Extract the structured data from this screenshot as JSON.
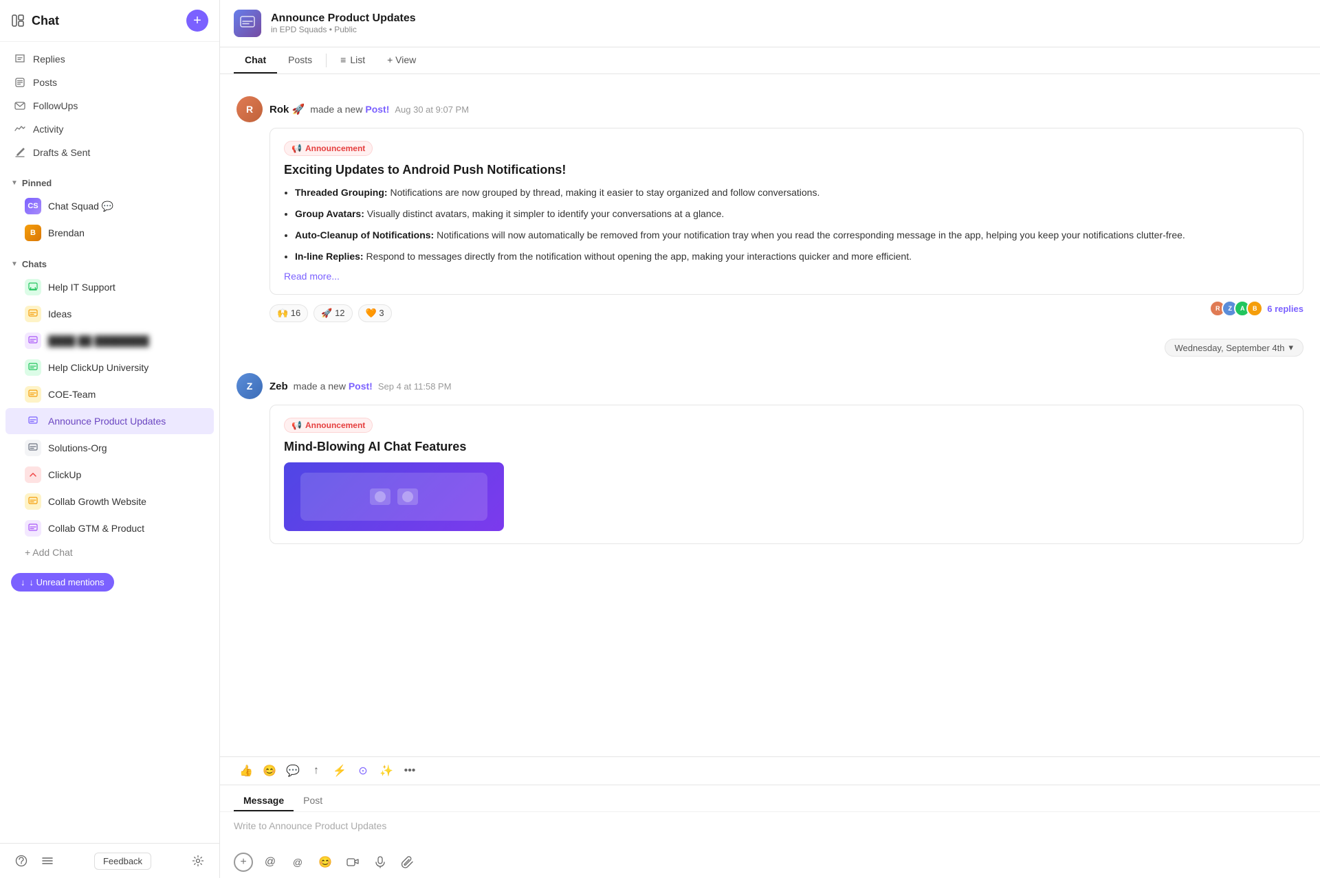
{
  "sidebar": {
    "title": "Chat",
    "add_button_label": "+",
    "nav_items": [
      {
        "id": "replies",
        "label": "Replies",
        "icon": "💬"
      },
      {
        "id": "posts",
        "label": "Posts",
        "icon": "📋"
      },
      {
        "id": "followups",
        "label": "FollowUps",
        "icon": "🔔"
      },
      {
        "id": "activity",
        "label": "Activity",
        "icon": "📊"
      },
      {
        "id": "drafts",
        "label": "Drafts & Sent",
        "icon": "✉️"
      }
    ],
    "pinned_section": {
      "label": "Pinned",
      "items": [
        {
          "id": "chat-squad",
          "label": "Chat Squad",
          "suffix": "💬",
          "color": "#7b61ff"
        },
        {
          "id": "brendan",
          "label": "Brendan",
          "color": "#f59e0b"
        }
      ]
    },
    "chats_section": {
      "label": "Chats",
      "items": [
        {
          "id": "help-it-support",
          "label": "Help IT Support",
          "color": "#22c55e",
          "bg": "#dcfce7"
        },
        {
          "id": "ideas",
          "label": "Ideas",
          "color": "#f59e0b",
          "bg": "#fef3c7"
        },
        {
          "id": "blurred",
          "label": "████ ██ ████████",
          "blurred": true,
          "color": "#a855f7",
          "bg": "#f3e8ff"
        },
        {
          "id": "help-clickup",
          "label": "Help ClickUp University",
          "color": "#22c55e",
          "bg": "#dcfce7"
        },
        {
          "id": "coe-team",
          "label": "COE-Team",
          "color": "#f59e0b",
          "bg": "#fef3c7"
        },
        {
          "id": "announce-product",
          "label": "Announce Product Updates",
          "color": "#a855f7",
          "bg": "#f3e8ff",
          "active": true
        },
        {
          "id": "solutions-org",
          "label": "Solutions-Org",
          "color": "#6b7280",
          "bg": "#f3f4f6"
        },
        {
          "id": "clickup",
          "label": "ClickUp",
          "color": "#ef4444",
          "bg": "#fee2e2"
        },
        {
          "id": "collab-growth",
          "label": "Collab Growth Website",
          "color": "#f59e0b",
          "bg": "#fef3c7"
        },
        {
          "id": "collab-gtm",
          "label": "Collab GTM & Product",
          "color": "#a855f7",
          "bg": "#f3e8ff"
        }
      ]
    },
    "add_chat_label": "+ Add Chat",
    "unread_mention_label": "↓ Unread mentions",
    "footer": {
      "feedback_label": "Feedback"
    }
  },
  "main": {
    "channel": {
      "name": "Announce Product Updates",
      "meta": "in EPD Squads • Public"
    },
    "tabs": [
      {
        "id": "chat",
        "label": "Chat",
        "active": true
      },
      {
        "id": "posts",
        "label": "Posts"
      },
      {
        "id": "list",
        "label": "List",
        "icon": "≡"
      },
      {
        "id": "view",
        "label": "+ View"
      }
    ],
    "messages": [
      {
        "id": "msg1",
        "user": "Rok 🚀",
        "avatar_color": "#e07b54",
        "avatar_initials": "R",
        "action": "made a new",
        "post_label": "Post!",
        "time": "Aug 30 at 9:07 PM",
        "post": {
          "badge": "📢 Announcement",
          "title": "Exciting Updates to Android Push Notifications!",
          "items": [
            {
              "bold": "Threaded Grouping:",
              "text": " Notifications are now grouped by thread, making it easier to stay organized and follow conversations."
            },
            {
              "bold": "Group Avatars:",
              "text": " Visually distinct avatars, making it simpler to identify your conversations at a glance."
            },
            {
              "bold": "Auto-Cleanup of Notifications:",
              "text": " Notifications will now automatically be removed from your notification tray when you read the corresponding message in the app, helping you keep your notifications clutter-free."
            },
            {
              "bold": "In-line Replies:",
              "text": " Respond to messages directly from the notification without opening the app, making your interactions quicker and more efficient."
            }
          ],
          "read_more": "Read more...",
          "reactions": [
            {
              "emoji": "🙌",
              "count": "16"
            },
            {
              "emoji": "🚀",
              "count": "12"
            },
            {
              "emoji": "🧡",
              "count": "3"
            }
          ],
          "replies_count": "6 replies",
          "reply_avatars": [
            "👤",
            "👤",
            "👤",
            "👤"
          ]
        }
      },
      {
        "id": "msg2",
        "user": "Zeb",
        "avatar_color": "#5b8dd9",
        "avatar_initials": "Z",
        "action": "made a new",
        "post_label": "Post!",
        "time": "Sep 4 at 11:58 PM",
        "post": {
          "badge": "📢 Announcement",
          "title": "Mind-Blowing AI Chat Features",
          "has_image": true
        }
      }
    ],
    "date_divider": "Wednesday, September 4th",
    "composer": {
      "tabs": [
        {
          "id": "message",
          "label": "Message",
          "active": true
        },
        {
          "id": "post",
          "label": "Post"
        }
      ],
      "placeholder": "Write to Announce Product Updates",
      "toolbar_items": [
        "👍",
        "😊",
        "💬",
        "↑",
        "⚡",
        "🔵",
        "😄",
        "•••"
      ]
    }
  }
}
